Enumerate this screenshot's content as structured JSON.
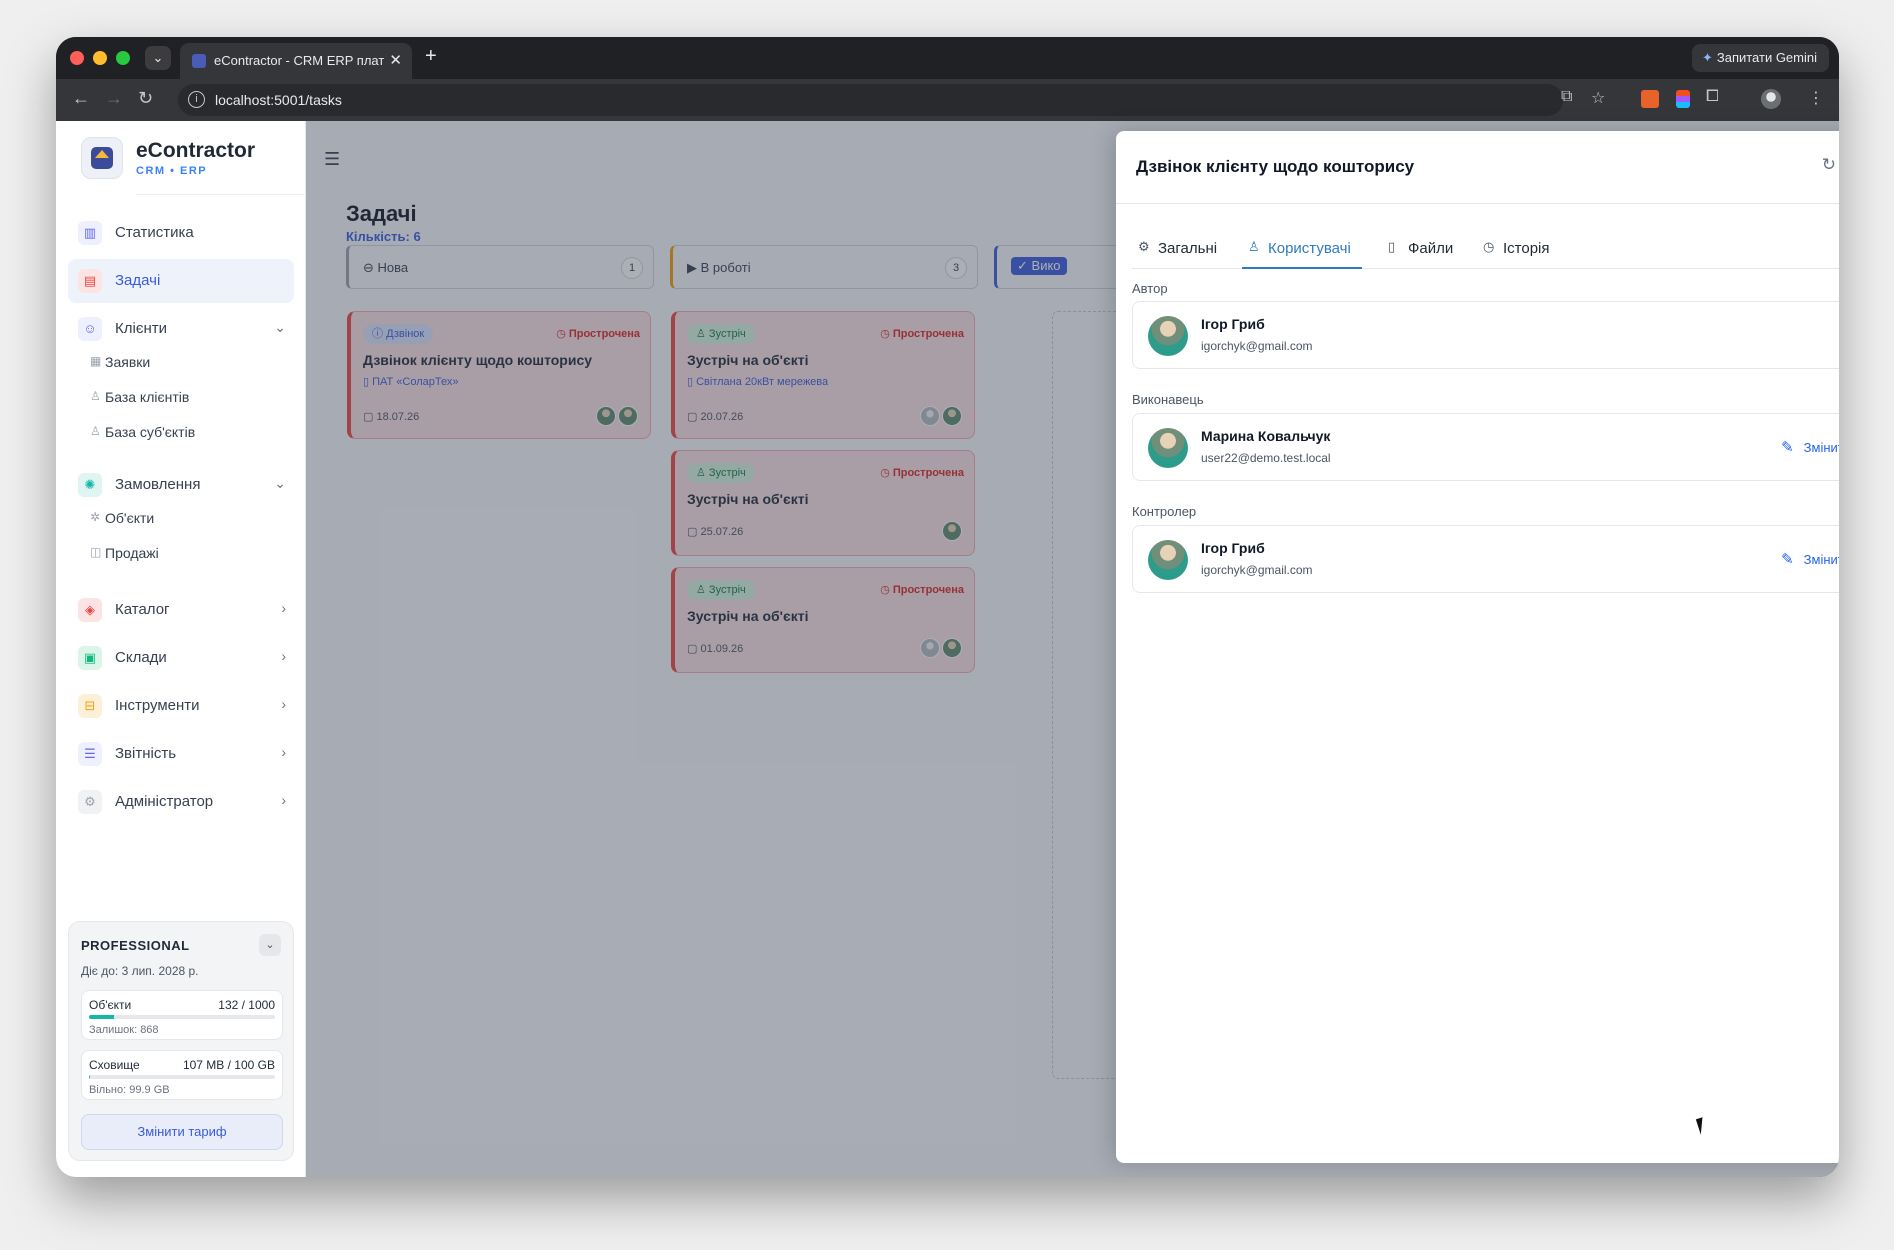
{
  "browser": {
    "tab_title": "eContractor - CRM ERP плат…",
    "url": "localhost:5001/tasks",
    "gemini_label": "Запитати Gemini"
  },
  "brand": {
    "title": "eContractor",
    "subtitle": "CRM • ERP"
  },
  "sidebar": {
    "items": [
      {
        "label": "Статистика",
        "icon": "bar-chart-icon",
        "color": "#6366f1"
      },
      {
        "label": "Задачі",
        "icon": "clipboard-icon",
        "color": "#ef4444",
        "active": true
      },
      {
        "label": "Клієнти",
        "icon": "users-icon",
        "color": "#6366f1",
        "expanded": true,
        "children": [
          {
            "label": "Заявки",
            "icon": "list-icon"
          },
          {
            "label": "База клієнтів",
            "icon": "person-icon"
          },
          {
            "label": "База суб'єктів",
            "icon": "person-icon"
          }
        ]
      },
      {
        "label": "Замовлення",
        "icon": "orders-icon",
        "color": "#14b8a6",
        "expanded": true,
        "children": [
          {
            "label": "Об'єкти",
            "icon": "gear-icon"
          },
          {
            "label": "Продажі",
            "icon": "bag-icon"
          }
        ]
      },
      {
        "label": "Каталог",
        "icon": "cube-icon",
        "color": "#ef4444"
      },
      {
        "label": "Склади",
        "icon": "warehouse-icon",
        "color": "#10b981"
      },
      {
        "label": "Інструменти",
        "icon": "toolbox-icon",
        "color": "#f59e0b"
      },
      {
        "label": "Звітність",
        "icon": "report-icon",
        "color": "#6366f1"
      },
      {
        "label": "Адміністратор",
        "icon": "gear-icon",
        "color": "#9ca3af"
      }
    ]
  },
  "plan": {
    "name": "PROFESSIONAL",
    "valid_until": "Діє до: 3 лип. 2028 р.",
    "objects": {
      "label": "Об'єкти",
      "value": "132 / 1000",
      "fraction": 0.132,
      "sub": "Залишок: 868"
    },
    "storage": {
      "label": "Сховище",
      "value": "107 MB / 100 GB",
      "fraction": 0.001,
      "sub": "Вільно: 99.9 GB"
    },
    "button": "Змінити тариф"
  },
  "main": {
    "title": "Задачі",
    "count": "Кількість: 6"
  },
  "columns": [
    {
      "label": "Нова",
      "icon": "⊖",
      "count": "1",
      "bg": "#f3f4f6"
    },
    {
      "label": "В роботі",
      "icon": "▶",
      "count": "3",
      "bg": "#fdf3d6"
    },
    {
      "label": "Вико",
      "icon": "✓",
      "count": "",
      "bg": "#e2e8fb"
    }
  ],
  "cards": [
    {
      "type": "Дзвінок",
      "overdue": "Прострочена",
      "title": "Дзвінок клієнту щодо кошторису",
      "client": "ПАТ «СоларТех»",
      "date": "18.07.26"
    },
    {
      "type": "Зустріч",
      "overdue": "Прострочена",
      "title": "Зустріч на об'єкті",
      "client": "Світлана 20кВт мережева",
      "date": "20.07.26"
    },
    {
      "type": "Зустріч",
      "overdue": "Прострочена",
      "title": "Зустріч на об'єкті",
      "client": "",
      "date": "25.07.26"
    },
    {
      "type": "Зустріч",
      "overdue": "Прострочена",
      "title": "Зустріч на об'єкті",
      "client": "",
      "date": "01.09.26"
    }
  ],
  "drawer": {
    "title": "Дзвінок клієнту щодо кошторису",
    "tabs": [
      {
        "label": "Загальні",
        "icon": "gear-icon"
      },
      {
        "label": "Користувачі",
        "icon": "user-icon",
        "active": true
      },
      {
        "label": "Файли",
        "icon": "file-icon"
      },
      {
        "label": "Історія",
        "icon": "history-icon"
      }
    ],
    "author": {
      "section": "Автор",
      "name": "Ігор Гриб",
      "email": "igorchyk@gmail.com"
    },
    "executor": {
      "section": "Виконавець",
      "name": "Марина Ковальчук",
      "email": "user22@demo.test.local",
      "action": "Змінити"
    },
    "controller": {
      "section": "Контролер",
      "name": "Ігор Гриб",
      "email": "igorchyk@gmail.com",
      "action": "Змінити"
    }
  }
}
